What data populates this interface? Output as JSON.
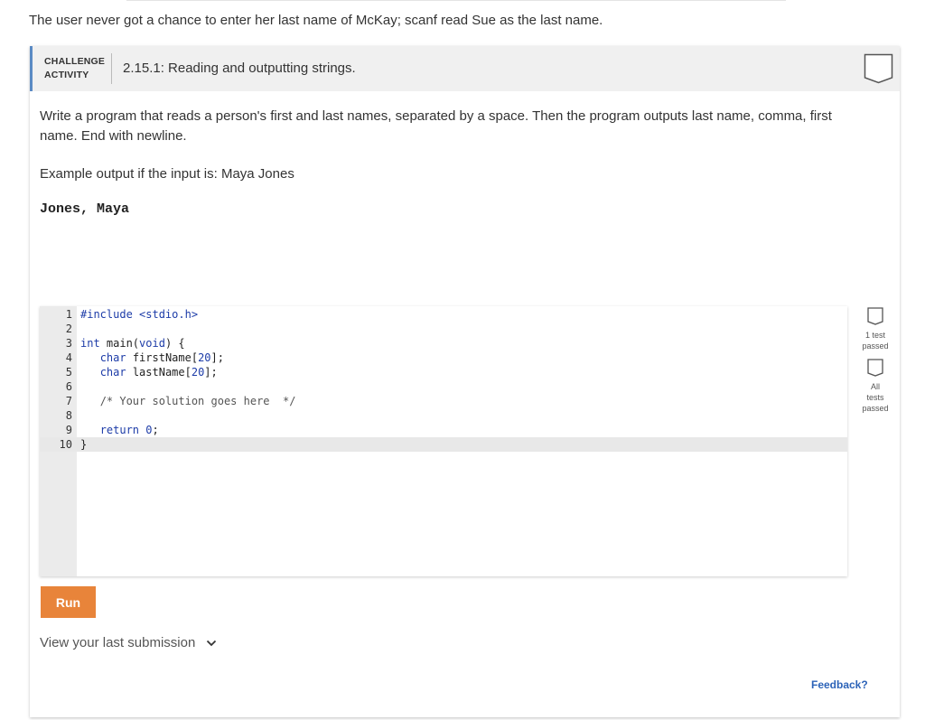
{
  "intro_text": "The user never got a chance to enter her last name of McKay; scanf read Sue as the last name.",
  "header": {
    "label_line1": "CHALLENGE",
    "label_line2": "ACTIVITY",
    "title": "2.15.1: Reading and outputting strings."
  },
  "description": "Write a program that reads a person's first and last names, separated by a space. Then the program outputs last name, comma, first name. End with newline.",
  "example_prompt": "Example output if the input is: Maya Jones",
  "example_output": "Jones, Maya",
  "editor": {
    "line_numbers": [
      "1",
      "2",
      "3",
      "4",
      "5",
      "6",
      "7",
      "8",
      "9",
      "10"
    ],
    "code": {
      "l1": "#include <stdio.h>",
      "l3_kw": "int",
      "l3_rest": " main(",
      "l3_kw2": "void",
      "l3_end": ") {",
      "l4_kw": "char",
      "l4_rest": " firstName[",
      "l4_num": "20",
      "l4_end": "];",
      "l5_kw": "char",
      "l5_rest": " lastName[",
      "l5_num": "20",
      "l5_end": "];",
      "l7": "/* Your solution goes here  */",
      "l9_kw": "return",
      "l9_num": "0",
      "l9_end": ";",
      "l10": "}"
    }
  },
  "tests": {
    "one_test": "1 test\npassed",
    "all_tests": "All tests\npassed"
  },
  "run_label": "Run",
  "last_submission_label": "View your last submission",
  "feedback_label": "Feedback?",
  "colors": {
    "accent_bar": "#5a8ac4",
    "run_button": "#e8843a",
    "feedback_link": "#2c63b8",
    "keyword": "#1d3ca8"
  },
  "icons": [
    "check-box-icon",
    "chevron-down-icon"
  ]
}
